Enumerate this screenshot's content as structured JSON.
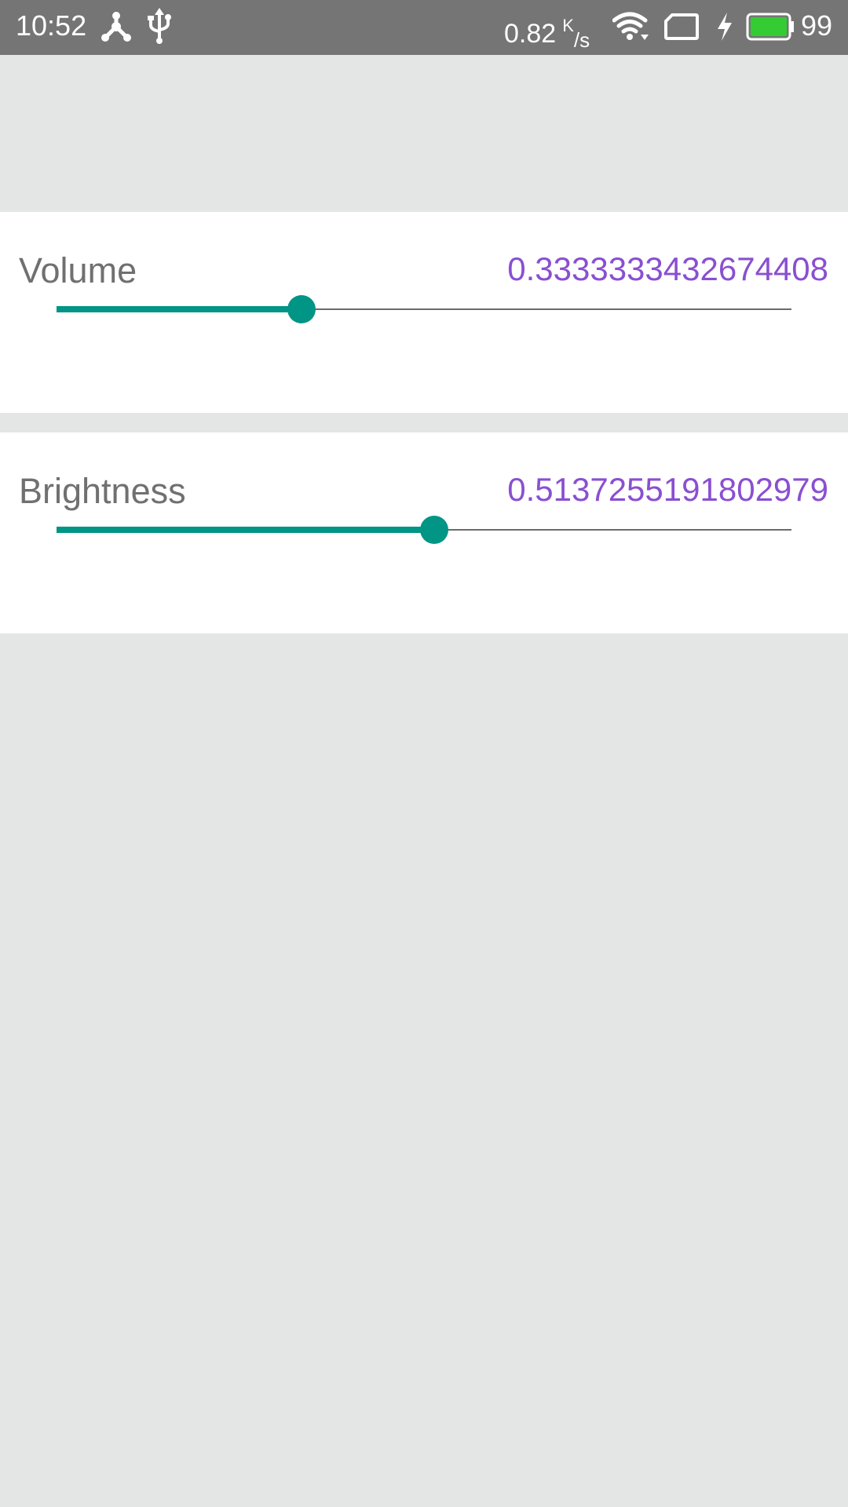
{
  "status_bar": {
    "time": "10:52",
    "net_speed_value": "0.82",
    "net_speed_unit_k": "K",
    "net_speed_unit_s": "/s",
    "battery_level": "99",
    "icons": [
      "share-hub-icon",
      "usb-icon",
      "wifi-icon",
      "screen-icon",
      "charging-icon",
      "battery-icon"
    ],
    "battery_color": "#33cc33"
  },
  "volume": {
    "label": "Volume",
    "value_text": "0.3333333432674408",
    "value": 0.3333333432674408
  },
  "brightness": {
    "label": "Brightness",
    "value_text": "0.5137255191802979",
    "value": 0.5137255191802979
  },
  "colors": {
    "accent": "#009585",
    "value_text": "#8a4fd1",
    "label_text": "#707070",
    "background": "#e4e5e5",
    "status_bar": "#757575"
  }
}
